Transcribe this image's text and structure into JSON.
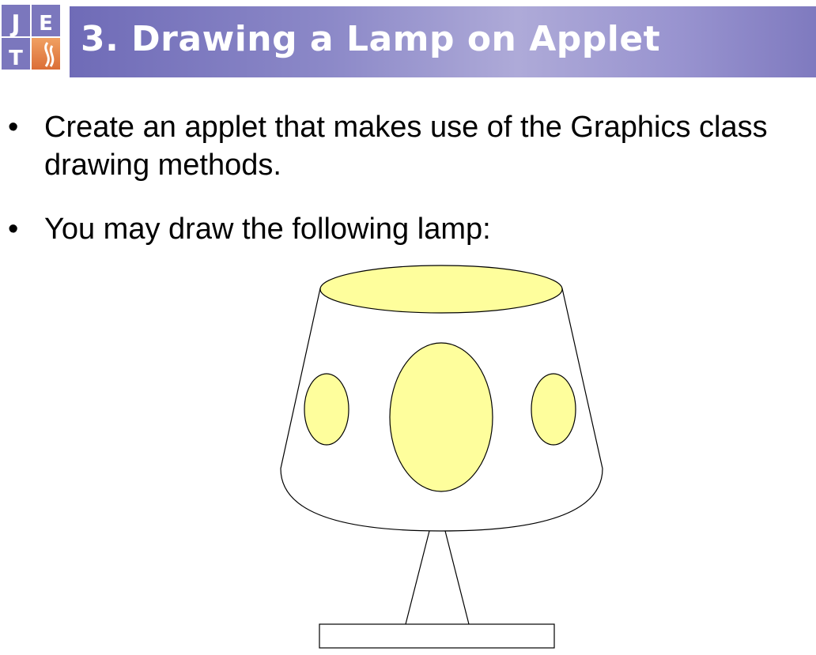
{
  "logo": {
    "letters": [
      "J",
      "E",
      "T"
    ]
  },
  "title": "3. Drawing a Lamp on Applet",
  "bullets": [
    {
      "marker": "•",
      "text": "Create an applet that makes use of the Graphics class drawing methods."
    },
    {
      "marker": "•",
      "text": "You may draw the following lamp:"
    }
  ],
  "colors": {
    "lamp_fill": "#fefe9c",
    "title_text": "#ffffff"
  }
}
